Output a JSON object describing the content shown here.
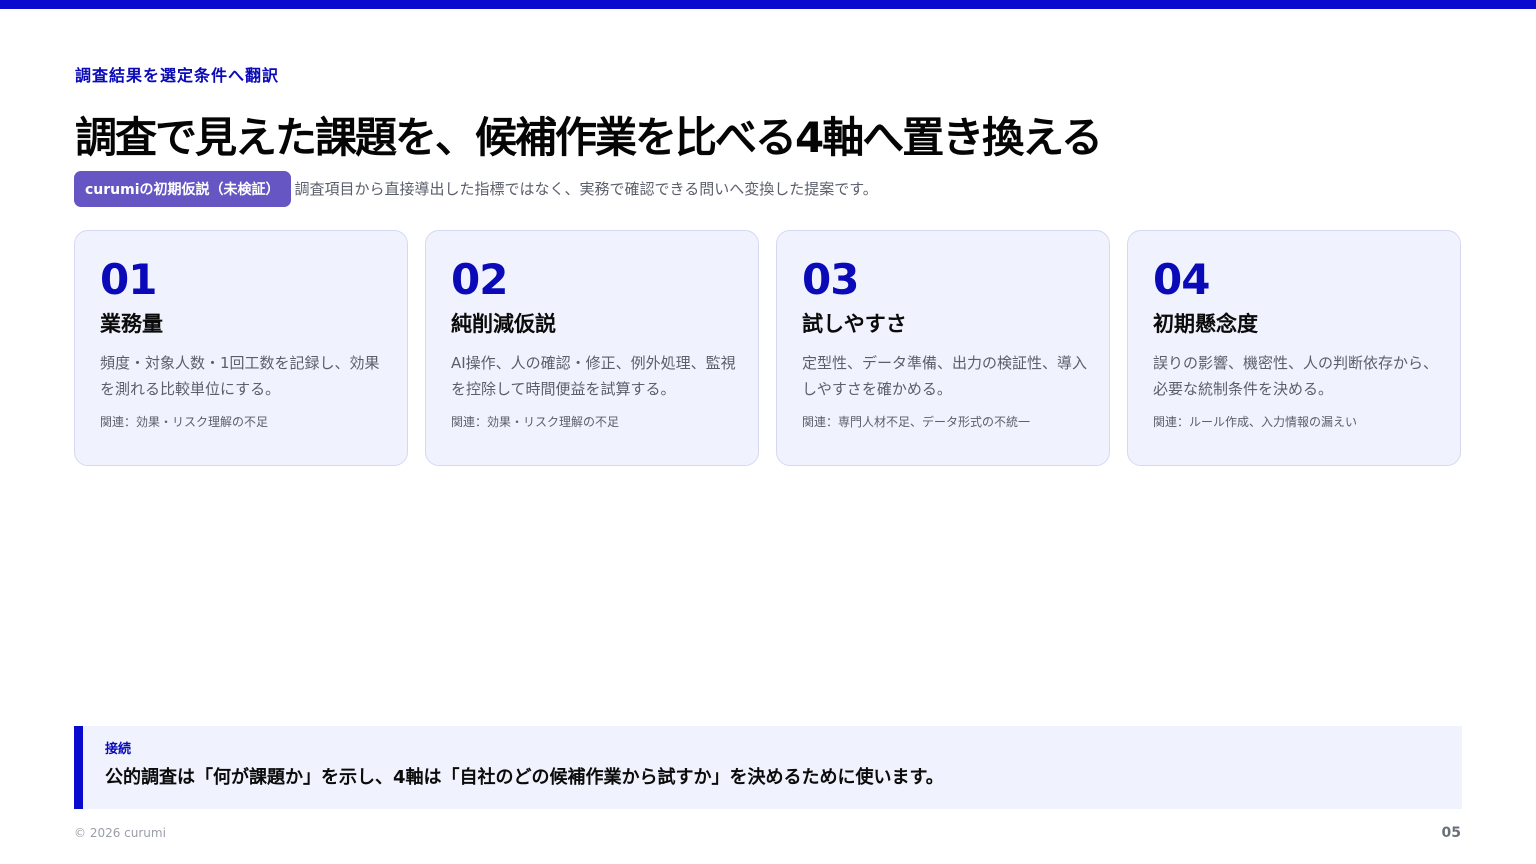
{
  "eyebrow": "調査結果を選定条件へ翻訳",
  "title": "調査で見えた課題を、候補作業を比べる4軸へ置き換える",
  "badge": "curumiの初期仮説（未検証）",
  "subtitle": "調査項目から直接導出した指標ではなく、実務で確認できる問いへ変換した提案です。",
  "cards": [
    {
      "num": "01",
      "title": "業務量",
      "desc": "頻度・対象人数・1回工数を記録し、効果を測れる比較単位にする。",
      "related": "関連：効果・リスク理解の不足"
    },
    {
      "num": "02",
      "title": "純削減仮説",
      "desc": "AI操作、人の確認・修正、例外処理、監視を控除して時間便益を試算する。",
      "related": "関連：効果・リスク理解の不足"
    },
    {
      "num": "03",
      "title": "試しやすさ",
      "desc": "定型性、データ準備、出力の検証性、導入しやすさを確かめる。",
      "related": "関連：専門人材不足、データ形式の不統一"
    },
    {
      "num": "04",
      "title": "初期懸念度",
      "desc": "誤りの影響、機密性、人の判断依存から、必要な統制条件を決める。",
      "related": "関連：ルール作成、入力情報の漏えい"
    }
  ],
  "connection": {
    "label": "接続",
    "text": "公的調査は「何が課題か」を示し、4軸は「自社のどの候補作業から試すか」を決めるために使います。"
  },
  "footer": {
    "copyright": "© 2026 curumi",
    "page": "05"
  },
  "colors": {
    "accent": "#0a0acf",
    "badge": "#6656c4",
    "card_bg": "#f0f3fd"
  }
}
